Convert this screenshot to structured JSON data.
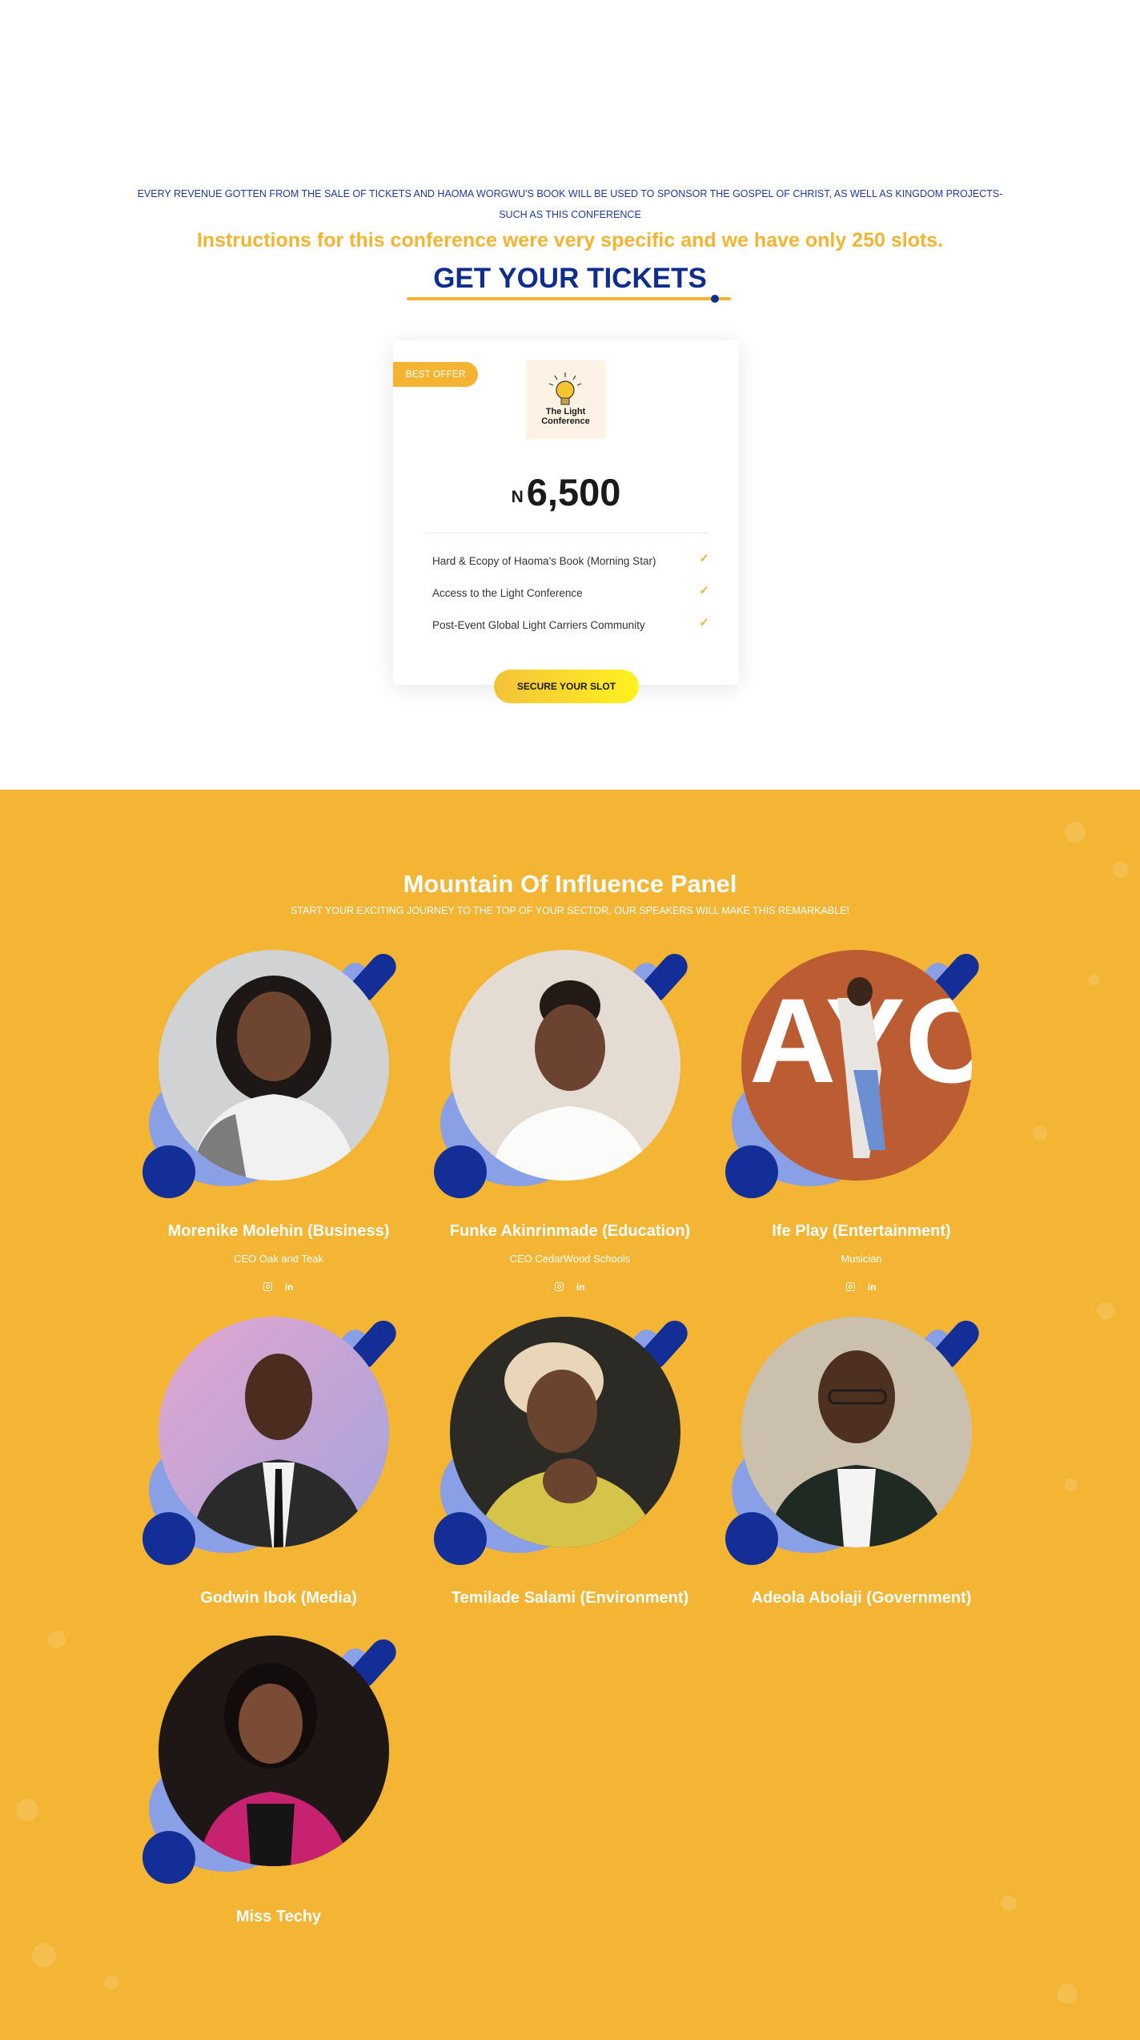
{
  "hero": {
    "notice": "EVERY REVENUE GOTTEN FROM THE SALE OF TICKETS AND HAOMA WORGWU'S BOOK WILL BE USED TO SPONSOR THE GOSPEL OF CHRIST, AS WELL AS KINGDOM PROJECTS- SUCH AS THIS CONFERENCE",
    "slots_text": "Instructions for this conference were very specific and we have only 250 slots.",
    "title": "GET YOUR TICKETS"
  },
  "ticket": {
    "badge": "BEST OFFER",
    "logo_text": "The Light Conference",
    "currency": "N",
    "price": "6,500",
    "features": [
      "Hard & Ecopy of Haoma's Book (Morning Star)",
      "Access to the Light Conference",
      "Post-Event Global Light Carriers Community"
    ],
    "cta": "SECURE YOUR SLOT"
  },
  "panel": {
    "title": "Mountain Of Influence Panel",
    "subtitle": "START YOUR EXCITING JOURNEY TO THE TOP OF YOUR SECTOR, OUR SPEAKERS WILL MAKE THIS REMARKABLE!",
    "speakers": [
      {
        "name": "Morenike Molehin (Business)",
        "role": "CEO Oak and Teak",
        "social": [
          "instagram-icon",
          "linkedin-icon"
        ]
      },
      {
        "name": "Funke Akinrinmade (Education)",
        "role": "CEO CedarWood Schools",
        "social": [
          "instagram-icon",
          "linkedin-icon"
        ]
      },
      {
        "name": "Ife Play (Entertainment)",
        "role": "Musician",
        "photo_text": "AYO IFE",
        "social": [
          "instagram-icon",
          "linkedin-icon"
        ]
      },
      {
        "name": "Godwin Ibok (Media)"
      },
      {
        "name": "Temilade Salami (Environment)"
      },
      {
        "name": "Adeola Abolaji (Government)"
      },
      {
        "name": "Miss Techy"
      }
    ],
    "linkedin_glyph": "in"
  },
  "colors": {
    "accent_yellow": "#f4b432",
    "navy": "#0f2d8f",
    "light_blue": "#8aa0e6",
    "panel_bg": "#f3b533"
  }
}
